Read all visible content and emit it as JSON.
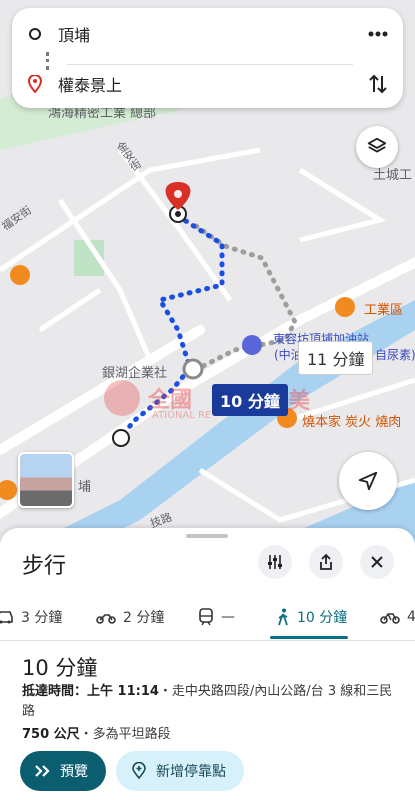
{
  "route": {
    "origin": "頂埔",
    "destination": "權泰景上"
  },
  "icons": {
    "origin": "circle-outline-icon",
    "destination": "red-pin-icon",
    "more": "more-horizontal-icon",
    "swap": "swap-vertical-icon",
    "layers": "layers-icon",
    "location": "navigation-arrow-icon"
  },
  "map": {
    "labels": {
      "top_partial": "鴻海精密工業 總部",
      "road_jinan": "金安街",
      "road_fuan": "福安街",
      "tucheng": "土城工",
      "industrial": "工業區",
      "gas_station": "東容坊頂埔加油站",
      "gas_station_sub": "(中油直營中",
      "gas_station_sub2": "自尿素)",
      "yinhu": "銀湖企業社",
      "bbq": "燒本家 炭火 燒肉",
      "dingpu_partial": "埔",
      "jishou": "技路",
      "watermark": "全國",
      "watermark2": "ATIONAL RE",
      "watermark_end": "美"
    },
    "time_primary": "10 分鐘",
    "time_alt": "11 分鐘"
  },
  "sheet": {
    "title": "步行",
    "modes": [
      {
        "icon": "car-icon",
        "label": "3 分鐘"
      },
      {
        "icon": "motorcycle-icon",
        "label": "2 分鐘"
      },
      {
        "icon": "transit-icon",
        "label": "—"
      },
      {
        "icon": "walk-icon",
        "label": "10 分鐘"
      },
      {
        "icon": "bicycle-icon",
        "label": "4"
      }
    ],
    "duration": "10 分鐘",
    "eta_label": "抵達時間：上午 11:14",
    "eta_route": "・走中央路四段/內山公路/台 3 線和三民路",
    "distance": "750 公尺",
    "distance_note": "・多為平坦路段",
    "preview_label": "預覽",
    "add_stop_label": "新增停靠點"
  },
  "colors": {
    "route_primary": "#1a4fe0",
    "route_alt": "#9e9e9e",
    "accent": "#0b5e70",
    "destination_pin": "#d93025"
  }
}
